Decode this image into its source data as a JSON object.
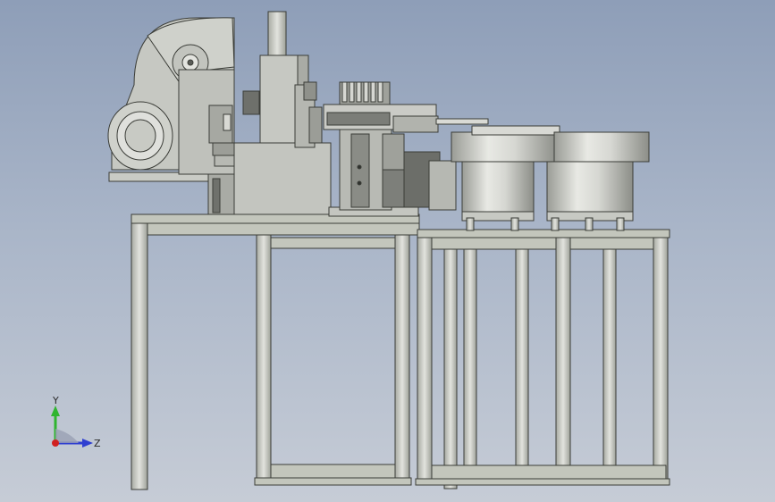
{
  "viewport": {
    "background_top": "#8e9eb8",
    "background_bottom": "#c6ccd6"
  },
  "triad": {
    "x_label": "X",
    "y_label": "Y",
    "z_label": "Z",
    "y_color": "#2fb52f",
    "z_color": "#2f3fd0",
    "x_color": "#d02020"
  },
  "model": {
    "description_hidden": "",
    "metal_color": "#c8cac4",
    "frame_color": "#bfc2b8",
    "edge_color": "#3b3d38"
  }
}
